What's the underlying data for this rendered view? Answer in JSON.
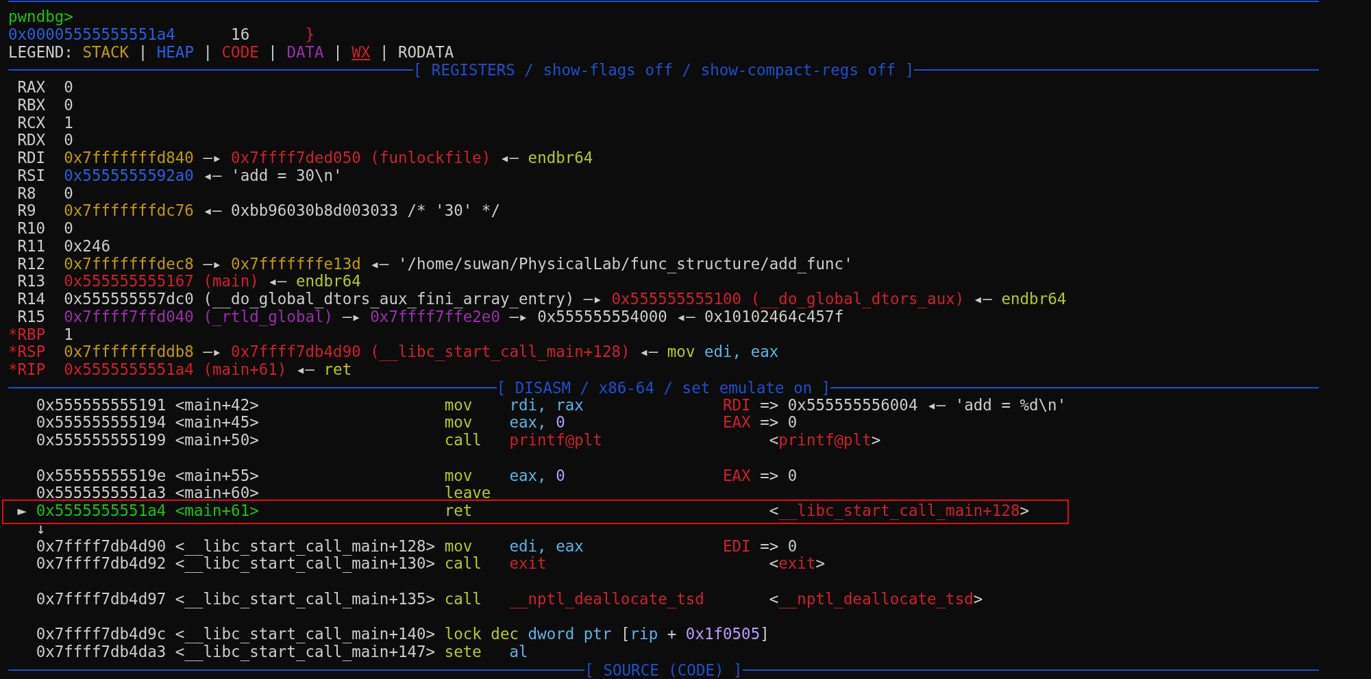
{
  "prompt": "pwndbg>",
  "source_line": {
    "address": "0x00005555555551a4",
    "line_number": "16",
    "code": "}"
  },
  "legend": {
    "label": "LEGEND:",
    "separator": "|",
    "items": [
      {
        "text": "STACK",
        "kind": "stack"
      },
      {
        "text": "HEAP",
        "kind": "heap"
      },
      {
        "text": "CODE",
        "kind": "code"
      },
      {
        "text": "DATA",
        "kind": "data"
      },
      {
        "text": "WX",
        "kind": "wx"
      },
      {
        "text": "RODATA",
        "kind": "plain"
      }
    ]
  },
  "registers": {
    "title": "[ REGISTERS / show-flags off / show-compact-regs off ]",
    "changed_marker": "*",
    "rows": [
      {
        "name": "RAX",
        "changed": false,
        "value": [
          {
            "text": "0",
            "kind": "plain"
          }
        ]
      },
      {
        "name": "RBX",
        "changed": false,
        "value": [
          {
            "text": "0",
            "kind": "plain"
          }
        ]
      },
      {
        "name": "RCX",
        "changed": false,
        "value": [
          {
            "text": "1",
            "kind": "plain"
          }
        ]
      },
      {
        "name": "RDX",
        "changed": false,
        "value": [
          {
            "text": "0",
            "kind": "plain"
          }
        ]
      },
      {
        "name": "RDI",
        "changed": false,
        "value": [
          {
            "text": "0x7fffffffd840",
            "kind": "stack"
          },
          {
            "text": "—▸",
            "kind": "plain"
          },
          {
            "text": "0x7ffff7ded050",
            "kind": "code"
          },
          {
            "text": "(funlockfile)",
            "kind": "code"
          },
          {
            "text": "◂—",
            "kind": "plain"
          },
          {
            "text": "endbr64",
            "kind": "opcode"
          }
        ]
      },
      {
        "name": "RSI",
        "changed": false,
        "value": [
          {
            "text": "0x5555555592a0",
            "kind": "heap"
          },
          {
            "text": "◂—",
            "kind": "plain"
          },
          {
            "text": "'add = 30\\n'",
            "kind": "plain"
          }
        ]
      },
      {
        "name": "R8",
        "changed": false,
        "value": [
          {
            "text": "0",
            "kind": "plain"
          }
        ]
      },
      {
        "name": "R9",
        "changed": false,
        "value": [
          {
            "text": "0x7fffffffdc76",
            "kind": "stack"
          },
          {
            "text": "◂—",
            "kind": "plain"
          },
          {
            "text": "0xbb96030b8d003033",
            "kind": "plain"
          },
          {
            "text": "/* '30' */",
            "kind": "plain"
          }
        ]
      },
      {
        "name": "R10",
        "changed": false,
        "value": [
          {
            "text": "0",
            "kind": "plain"
          }
        ]
      },
      {
        "name": "R11",
        "changed": false,
        "value": [
          {
            "text": "0x246",
            "kind": "plain"
          }
        ]
      },
      {
        "name": "R12",
        "changed": false,
        "value": [
          {
            "text": "0x7fffffffdec8",
            "kind": "stack"
          },
          {
            "text": "—▸",
            "kind": "plain"
          },
          {
            "text": "0x7fffffffe13d",
            "kind": "stack"
          },
          {
            "text": "◂—",
            "kind": "plain"
          },
          {
            "text": "'/home/suwan/PhysicalLab/func_structure/add_func'",
            "kind": "plain"
          }
        ]
      },
      {
        "name": "R13",
        "changed": false,
        "value": [
          {
            "text": "0x555555555167",
            "kind": "code"
          },
          {
            "text": "(main)",
            "kind": "code"
          },
          {
            "text": "◂—",
            "kind": "plain"
          },
          {
            "text": "endbr64",
            "kind": "opcode"
          }
        ]
      },
      {
        "name": "R14",
        "changed": false,
        "value": [
          {
            "text": "0x555555557dc0",
            "kind": "plain"
          },
          {
            "text": "(__do_global_dtors_aux_fini_array_entry)",
            "kind": "plain"
          },
          {
            "text": "—▸",
            "kind": "plain"
          },
          {
            "text": "0x555555555100",
            "kind": "code"
          },
          {
            "text": "(__do_global_dtors_aux)",
            "kind": "code"
          },
          {
            "text": "◂—",
            "kind": "plain"
          },
          {
            "text": "endbr64",
            "kind": "opcode"
          }
        ]
      },
      {
        "name": "R15",
        "changed": false,
        "value": [
          {
            "text": "0x7ffff7ffd040",
            "kind": "data"
          },
          {
            "text": "(_rtld_global)",
            "kind": "data"
          },
          {
            "text": "—▸",
            "kind": "plain"
          },
          {
            "text": "0x7ffff7ffe2e0",
            "kind": "data"
          },
          {
            "text": "—▸",
            "kind": "plain"
          },
          {
            "text": "0x555555554000",
            "kind": "plain"
          },
          {
            "text": "◂—",
            "kind": "plain"
          },
          {
            "text": "0x10102464c457f",
            "kind": "plain"
          }
        ]
      },
      {
        "name": "RBP",
        "changed": true,
        "value": [
          {
            "text": "1",
            "kind": "plain"
          }
        ]
      },
      {
        "name": "RSP",
        "changed": true,
        "value": [
          {
            "text": "0x7fffffffddb8",
            "kind": "stack"
          },
          {
            "text": "—▸",
            "kind": "plain"
          },
          {
            "text": "0x7ffff7db4d90",
            "kind": "code"
          },
          {
            "text": "(__libc_start_call_main+128)",
            "kind": "code"
          },
          {
            "text": "◂—",
            "kind": "plain"
          },
          {
            "text": "mov",
            "kind": "opcode"
          },
          {
            "text": "edi,",
            "kind": "register"
          },
          {
            "text": "eax",
            "kind": "register"
          }
        ]
      },
      {
        "name": "RIP",
        "changed": true,
        "value": [
          {
            "text": "0x5555555551a4",
            "kind": "code"
          },
          {
            "text": "(main+61)",
            "kind": "code"
          },
          {
            "text": "◂—",
            "kind": "plain"
          },
          {
            "text": "ret",
            "kind": "opcode"
          }
        ]
      }
    ]
  },
  "disasm": {
    "title": "[ DISASM / x86-64 / set emulate on ]",
    "current_marker": "►",
    "groups": [
      [
        {
          "address": "0x555555555191",
          "symbol": "<main+42>",
          "mnemonic": "mov",
          "selected": false,
          "operands": [
            {
              "text": "rdi,",
              "kind": "register"
            },
            {
              "text": "rax",
              "kind": "register"
            }
          ],
          "annotation": {
            "kind": "emulation",
            "parts": [
              {
                "text": "RDI",
                "kind": "code"
              },
              {
                "text": "=>",
                "kind": "plain"
              },
              {
                "text": "0x555555556004",
                "kind": "plain"
              },
              {
                "text": "◂—",
                "kind": "plain"
              },
              {
                "text": "'add = %d\\n'",
                "kind": "plain"
              }
            ]
          }
        },
        {
          "address": "0x555555555194",
          "symbol": "<main+45>",
          "mnemonic": "mov",
          "selected": false,
          "operands": [
            {
              "text": "eax,",
              "kind": "register"
            },
            {
              "text": "0",
              "kind": "number"
            }
          ],
          "annotation": {
            "kind": "emulation",
            "parts": [
              {
                "text": "EAX",
                "kind": "code"
              },
              {
                "text": "=>",
                "kind": "plain"
              },
              {
                "text": "0",
                "kind": "plain"
              }
            ]
          }
        },
        {
          "address": "0x555555555199",
          "symbol": "<main+50>",
          "mnemonic": "call",
          "selected": false,
          "operands": [
            {
              "text": "printf@plt",
              "kind": "code"
            }
          ],
          "annotation": {
            "kind": "target",
            "parts": [
              {
                "text": "<",
                "kind": "plain"
              },
              {
                "text": "printf@plt",
                "kind": "code",
                "glue": true
              },
              {
                "text": ">",
                "kind": "plain",
                "glue": true
              }
            ]
          }
        }
      ],
      [
        {
          "address": "0x55555555519e",
          "symbol": "<main+55>",
          "mnemonic": "mov",
          "selected": false,
          "operands": [
            {
              "text": "eax,",
              "kind": "register"
            },
            {
              "text": "0",
              "kind": "number"
            }
          ],
          "annotation": {
            "kind": "emulation",
            "parts": [
              {
                "text": "EAX",
                "kind": "code"
              },
              {
                "text": "=>",
                "kind": "plain"
              },
              {
                "text": "0",
                "kind": "plain"
              }
            ]
          }
        },
        {
          "address": "0x5555555551a3",
          "symbol": "<main+60>",
          "mnemonic": "leave",
          "selected": false
        },
        {
          "address": "0x5555555551a4",
          "symbol": "<main+61>",
          "mnemonic": "ret",
          "selected": true,
          "branch_arrow": "↓",
          "annotation": {
            "kind": "target",
            "parts": [
              {
                "text": "<",
                "kind": "plain"
              },
              {
                "text": "__libc_start_call_main+128",
                "kind": "code",
                "glue": true
              },
              {
                "text": ">",
                "kind": "plain",
                "glue": true
              }
            ]
          }
        }
      ],
      [
        {
          "address": "0x7ffff7db4d90",
          "symbol": "<__libc_start_call_main+128>",
          "mnemonic": "mov",
          "selected": false,
          "operands": [
            {
              "text": "edi,",
              "kind": "register"
            },
            {
              "text": "eax",
              "kind": "register"
            }
          ],
          "annotation": {
            "kind": "emulation",
            "parts": [
              {
                "text": "EDI",
                "kind": "code"
              },
              {
                "text": "=>",
                "kind": "plain"
              },
              {
                "text": "0",
                "kind": "plain"
              }
            ]
          }
        },
        {
          "address": "0x7ffff7db4d92",
          "symbol": "<__libc_start_call_main+130>",
          "mnemonic": "call",
          "selected": false,
          "operands": [
            {
              "text": "exit",
              "kind": "code"
            }
          ],
          "annotation": {
            "kind": "target",
            "parts": [
              {
                "text": "<",
                "kind": "plain"
              },
              {
                "text": "exit",
                "kind": "code",
                "glue": true
              },
              {
                "text": ">",
                "kind": "plain",
                "glue": true
              }
            ]
          }
        }
      ],
      [
        {
          "address": "0x7ffff7db4d97",
          "symbol": "<__libc_start_call_main+135>",
          "mnemonic": "call",
          "selected": false,
          "operands": [
            {
              "text": "__nptl_deallocate_tsd",
              "kind": "code"
            }
          ],
          "annotation": {
            "kind": "target",
            "parts": [
              {
                "text": "<",
                "kind": "plain"
              },
              {
                "text": "__nptl_deallocate_tsd",
                "kind": "code",
                "glue": true
              },
              {
                "text": ">",
                "kind": "plain",
                "glue": true
              }
            ]
          }
        }
      ],
      [
        {
          "address": "0x7ffff7db4d9c",
          "symbol": "<__libc_start_call_main+140>",
          "mnemonic": "lock dec",
          "selected": false,
          "operands": [
            {
              "text": "dword",
              "kind": "register"
            },
            {
              "text": "ptr",
              "kind": "register"
            },
            {
              "text": "[",
              "kind": "plain"
            },
            {
              "text": "rip",
              "kind": "register",
              "glue": true
            },
            {
              "text": "+",
              "kind": "plain"
            },
            {
              "text": "0x1f0505",
              "kind": "number"
            },
            {
              "text": "]",
              "kind": "plain",
              "glue": true
            }
          ]
        },
        {
          "address": "0x7ffff7db4da3",
          "symbol": "<__libc_start_call_main+147>",
          "mnemonic": "sete",
          "selected": false,
          "operands": [
            {
              "text": "al",
              "kind": "register"
            }
          ]
        }
      ]
    ]
  },
  "source": {
    "title": "[ SOURCE (CODE) ]"
  }
}
